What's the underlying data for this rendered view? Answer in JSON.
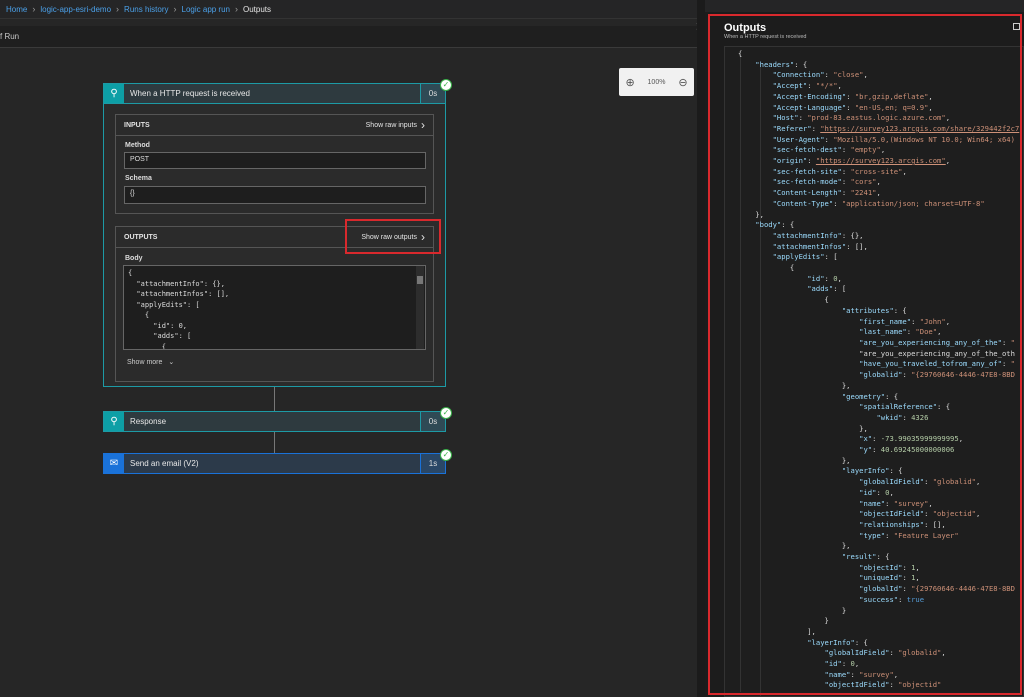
{
  "breadcrumb": [
    "Home",
    "logic-app-esri-demo",
    "Runs history",
    "Logic app run",
    "Outputs"
  ],
  "toolbar": {
    "run_label": "f Run"
  },
  "zoom": {
    "level": "100%"
  },
  "trigger": {
    "title": "When a HTTP request is received",
    "duration": "0s",
    "inputs": {
      "header": "INPUTS",
      "raw_link": "Show raw inputs",
      "method_label": "Method",
      "method_value": "POST",
      "schema_label": "Schema",
      "schema_value": "{}"
    },
    "outputs": {
      "header": "OUTPUTS",
      "raw_link": "Show raw outputs",
      "body_label": "Body",
      "body_lines": [
        "{",
        "  \"attachmentInfo\": {},",
        "  \"attachmentInfos\": [],",
        "  \"applyEdits\": [",
        "    {",
        "      \"id\": 0,",
        "      \"adds\": [",
        "        {"
      ]
    },
    "show_more": "Show more"
  },
  "actions": [
    {
      "title": "Response",
      "duration": "0s",
      "icon": "http-request-icon",
      "color": "#0d9fa6"
    },
    {
      "title": "Send an email (V2)",
      "duration": "1s",
      "icon": "outlook-icon",
      "color": "#1a72d9"
    }
  ],
  "outputs_panel": {
    "title": "Outputs",
    "subtitle": "When a HTTP request is received",
    "json_lines": [
      "{",
      "    \"headers\": {",
      "        \"Connection\": \"close\",",
      "        \"Accept\": \"*/*\",",
      "        \"Accept-Encoding\": \"br,gzip,deflate\",",
      "        \"Accept-Language\": \"en-US,en; q=0.9\",",
      "        \"Host\": \"prod-83.eastus.logic.azure.com\",",
      "        \"Referer\": \"https://survey123.arcgis.com/share/329442f2c7",
      "        \"User-Agent\": \"Mozilla/5.0,(Windows NT 10.0; Win64; x64)",
      "        \"sec-fetch-dest\": \"empty\",",
      "        \"origin\": \"https://survey123.arcgis.com\",",
      "        \"sec-fetch-site\": \"cross-site\",",
      "        \"sec-fetch-mode\": \"cors\",",
      "        \"Content-Length\": \"2241\",",
      "        \"Content-Type\": \"application/json; charset=UTF-8\"",
      "    },",
      "    \"body\": {",
      "        \"attachmentInfo\": {},",
      "        \"attachmentInfos\": [],",
      "        \"applyEdits\": [",
      "            {",
      "                \"id\": 0,",
      "                \"adds\": [",
      "                    {",
      "                        \"attributes\": {",
      "                            \"first_name\": \"John\",",
      "                            \"last_name\": \"Doe\",",
      "                            \"are_you_experiencing_any_of_the\": \"",
      "                            \"are_you_experiencing_any_of_the_oth",
      "                            \"have_you_traveled_tofrom_any_of\": \"",
      "                            \"globalid\": \"{29760646-4446-47E8-8BD",
      "                        },",
      "                        \"geometry\": {",
      "                            \"spatialReference\": {",
      "                                \"wkid\": 4326",
      "                            },",
      "                            \"x\": -73.99035999999995,",
      "                            \"y\": 40.69245000000006",
      "                        },",
      "                        \"layerInfo\": {",
      "                            \"globalIdField\": \"globalid\",",
      "                            \"id\": 0,",
      "                            \"name\": \"survey\",",
      "                            \"objectIdField\": \"objectid\",",
      "                            \"relationships\": [],",
      "                            \"type\": \"Feature Layer\"",
      "                        },",
      "                        \"result\": {",
      "                            \"objectId\": 1,",
      "                            \"uniqueId\": 1,",
      "                            \"globalId\": \"{29760646-4446-47E8-8BD",
      "                            \"success\": true",
      "                        }",
      "                    }",
      "                ],",
      "                \"layerInfo\": {",
      "                    \"globalIdField\": \"globalid\",",
      "                    \"id\": 0,",
      "                    \"name\": \"survey\",",
      "                    \"objectIdField\": \"objectid\""
    ]
  },
  "colors": {
    "accent_teal": "#0d9fa6",
    "accent_blue": "#1a72d9",
    "highlight_red": "#d9292d",
    "success_green": "#3bb24a"
  }
}
